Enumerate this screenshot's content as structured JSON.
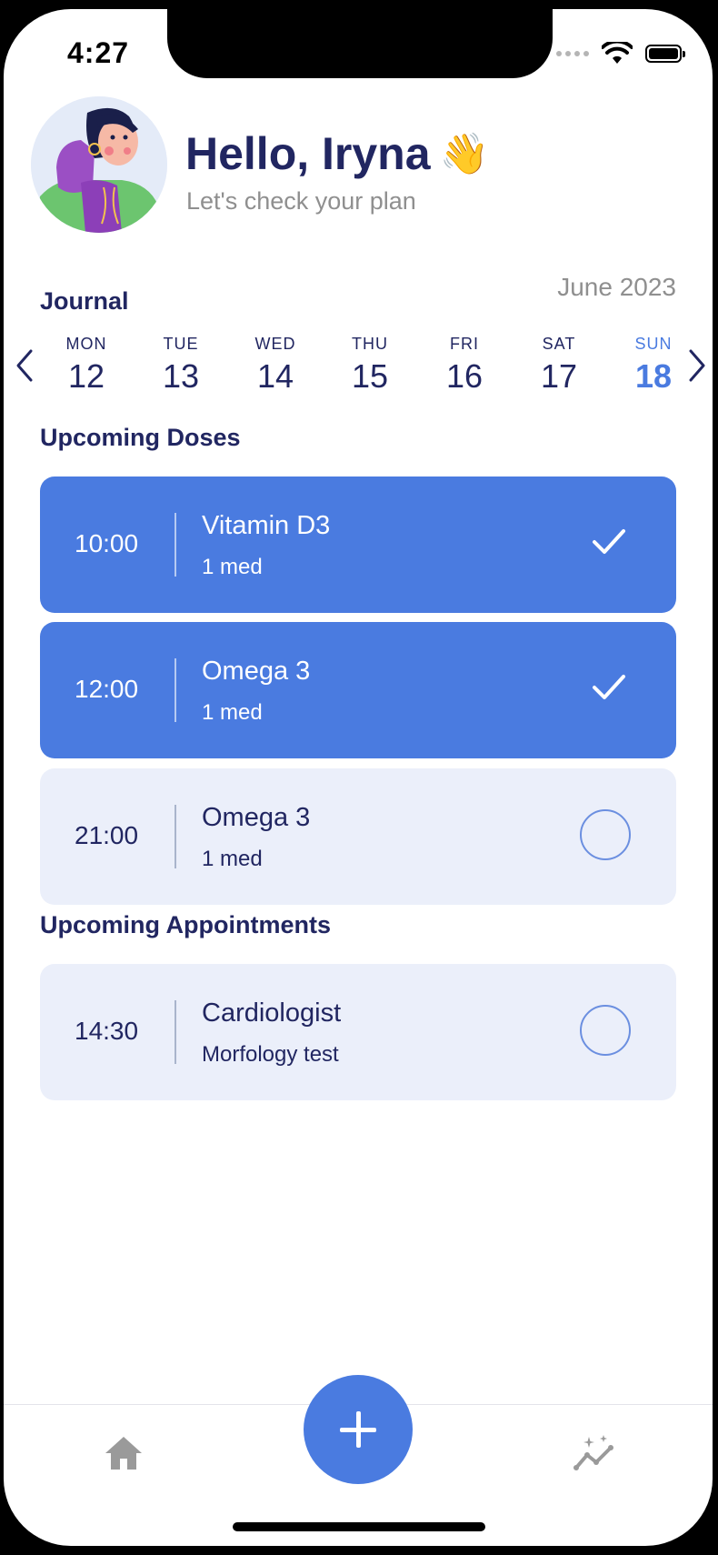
{
  "status_bar": {
    "time": "4:27"
  },
  "header": {
    "greeting": "Hello, Iryna",
    "wave_emoji": "👋",
    "subtitle": "Let's check your plan"
  },
  "journal": {
    "title": "Journal",
    "month": "June 2023",
    "days": [
      {
        "name": "MON",
        "num": "12"
      },
      {
        "name": "TUE",
        "num": "13"
      },
      {
        "name": "WED",
        "num": "14"
      },
      {
        "name": "THU",
        "num": "15"
      },
      {
        "name": "FRI",
        "num": "16"
      },
      {
        "name": "SAT",
        "num": "17"
      },
      {
        "name": "SUN",
        "num": "18",
        "selected": true
      }
    ]
  },
  "doses": {
    "title": "Upcoming Doses",
    "items": [
      {
        "time": "10:00",
        "name": "Vitamin D3",
        "detail": "1 med",
        "status": "done"
      },
      {
        "time": "12:00",
        "name": "Omega 3",
        "detail": "1 med",
        "status": "done"
      },
      {
        "time": "21:00",
        "name": "Omega 3",
        "detail": "1 med",
        "status": "pending"
      }
    ]
  },
  "appointments": {
    "title": "Upcoming Appointments",
    "items": [
      {
        "time": "14:30",
        "name": "Cardiologist",
        "detail": "Morfology test",
        "status": "pending"
      }
    ]
  },
  "tab_bar": {
    "items": [
      {
        "icon": "home-icon"
      },
      {
        "icon": "plus-icon"
      },
      {
        "icon": "stats-icon"
      }
    ]
  },
  "colors": {
    "accent": "#4a7be0",
    "navy": "#212661",
    "pending_card": "#ebeffa",
    "muted_text": "#8f8f8f"
  }
}
